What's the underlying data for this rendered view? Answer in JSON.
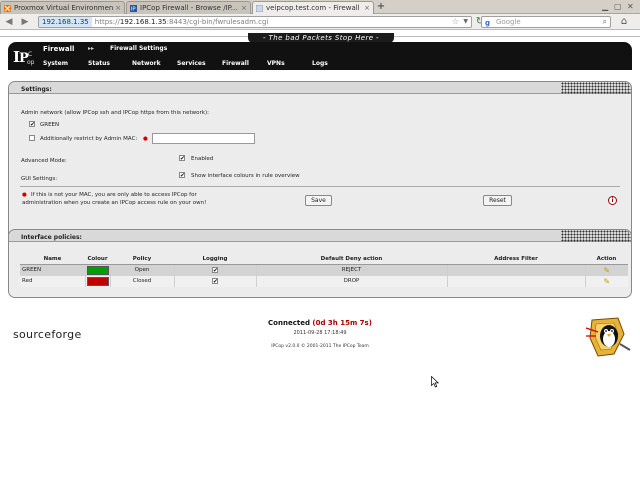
{
  "browser": {
    "tabs": [
      {
        "label": "Proxmox Virtual Environment",
        "active": false
      },
      {
        "label": "IPCop Firewall - Browse /IP...",
        "active": false
      },
      {
        "label": "veipcop.test.com - Firewall ...",
        "active": true
      }
    ],
    "new_tab": "+",
    "url": {
      "site_badge": "192.168.1.35",
      "scheme": "https://",
      "host": "192.168.1.35",
      "rest": ":8443/cgi-bin/fwrulesadm.cgi"
    },
    "search_placeholder": "Google"
  },
  "page": {
    "slogan": "- The bad Packets Stop Here -",
    "header": {
      "title": "Firewall",
      "arrow": "▸▸",
      "subtitle": "Firewall Settings",
      "menu": [
        "System",
        "Status",
        "Network",
        "Services",
        "Firewall",
        "VPNs",
        "Logs"
      ]
    },
    "settings": {
      "title": "Settings:",
      "admin_network_label": "Admin network (allow IPCop ssh and IPCop https from this network):",
      "green_label": "GREEN",
      "green_checked": true,
      "restrict_mac_label": "Additionally restrict by Admin MAC:",
      "restrict_mac_checked": false,
      "mac_value": "",
      "advanced_mode_label": "Advanced Mode:",
      "advanced_enabled_label": "Enabled",
      "advanced_checked": true,
      "gui_settings_label": "GUI Settings:",
      "gui_option_label": "Show interface colours in rule overview",
      "gui_checked": true,
      "note_line1": "If this is not your MAC, you are only able to access IPCop for",
      "note_line2": "administration when you create an IPCop access rule on your own!",
      "save_label": "Save",
      "reset_label": "Reset",
      "info_symbol": "i"
    },
    "policies": {
      "title": "Interface policies:",
      "columns": [
        "Name",
        "Colour",
        "Policy",
        "Logging",
        "Default Deny action",
        "Address Filter",
        "Action"
      ],
      "rows": [
        {
          "name": "GREEN",
          "colour": "#00a000",
          "policy": "Open",
          "logging": "✔",
          "deny_action": "REJECT",
          "address_filter": "",
          "action_icon": "pencil-icon"
        },
        {
          "name": "Red",
          "colour": "#c00000",
          "policy": "Closed",
          "logging": "✔",
          "deny_action": "DROP",
          "address_filter": "",
          "action_icon": "pencil-icon"
        }
      ]
    },
    "footer": {
      "sourceforge": "sourceforge",
      "connected_label": "Connected",
      "uptime": "(0d 3h 15m 7s)",
      "datetime": "2011-09-28 17:18:49",
      "copyright": "IPCop v2.0.0 © 2001-2011 The IPCop Team"
    }
  }
}
